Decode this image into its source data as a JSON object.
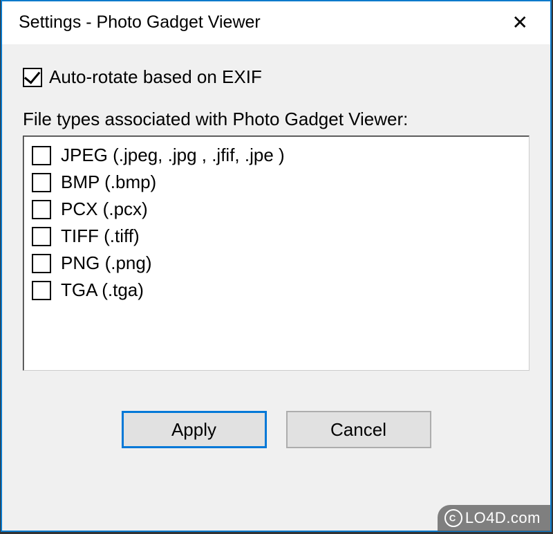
{
  "window": {
    "title": "Settings - Photo Gadget Viewer"
  },
  "settings": {
    "autoRotate": {
      "label": "Auto-rotate based on EXIF",
      "checked": true
    },
    "fileTypesLabel": "File types associated with Photo Gadget Viewer:",
    "fileTypes": [
      {
        "label": "JPEG (.jpeg, .jpg , .jfif, .jpe )",
        "checked": false
      },
      {
        "label": "BMP (.bmp)",
        "checked": false
      },
      {
        "label": "PCX (.pcx)",
        "checked": false
      },
      {
        "label": "TIFF (.tiff)",
        "checked": false
      },
      {
        "label": "PNG (.png)",
        "checked": false
      },
      {
        "label": "TGA  (.tga)",
        "checked": false
      }
    ]
  },
  "buttons": {
    "apply": "Apply",
    "cancel": "Cancel"
  },
  "watermark": {
    "text": "LO4D.com"
  }
}
